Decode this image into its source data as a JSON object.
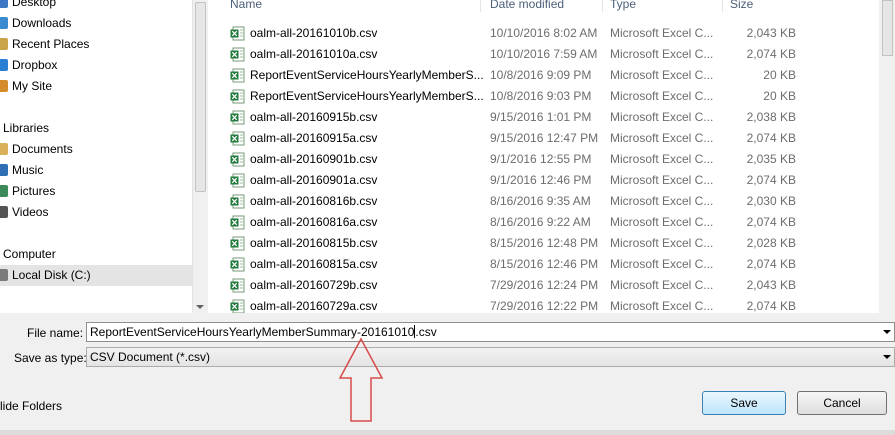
{
  "nav": {
    "items": [
      {
        "label": "Desktop",
        "icon": "desktop-icon",
        "group": false,
        "selected": false
      },
      {
        "label": "Downloads",
        "icon": "downloads-icon",
        "group": false,
        "selected": false
      },
      {
        "label": "Recent Places",
        "icon": "recent-places-icon",
        "group": false,
        "selected": false
      },
      {
        "label": "Dropbox",
        "icon": "dropbox-icon",
        "group": false,
        "selected": false
      },
      {
        "label": "My Site",
        "icon": "site-icon",
        "group": false,
        "selected": false
      },
      {
        "label": "Libraries",
        "icon": "",
        "group": true,
        "selected": false
      },
      {
        "label": "Documents",
        "icon": "documents-icon",
        "group": false,
        "selected": false
      },
      {
        "label": "Music",
        "icon": "music-icon",
        "group": false,
        "selected": false
      },
      {
        "label": "Pictures",
        "icon": "pictures-icon",
        "group": false,
        "selected": false
      },
      {
        "label": "Videos",
        "icon": "videos-icon",
        "group": false,
        "selected": false
      },
      {
        "label": "Computer",
        "icon": "",
        "group": true,
        "selected": false
      },
      {
        "label": "Local Disk (C:)",
        "icon": "local-disk-icon",
        "group": false,
        "selected": true
      }
    ]
  },
  "columns": {
    "name": "Name",
    "date": "Date modified",
    "type": "Type",
    "size": "Size"
  },
  "files": [
    {
      "name": "oalm-all-20161010b.csv",
      "date": "10/10/2016 8:02 AM",
      "type": "Microsoft Excel C...",
      "size": "2,043 KB"
    },
    {
      "name": "oalm-all-20161010a.csv",
      "date": "10/10/2016 7:59 AM",
      "type": "Microsoft Excel C...",
      "size": "2,074 KB"
    },
    {
      "name": "ReportEventServiceHoursYearlyMemberS...",
      "date": "10/8/2016 9:09 PM",
      "type": "Microsoft Excel C...",
      "size": "20 KB"
    },
    {
      "name": "ReportEventServiceHoursYearlyMemberS...",
      "date": "10/8/2016 9:03 PM",
      "type": "Microsoft Excel C...",
      "size": "20 KB"
    },
    {
      "name": "oalm-all-20160915b.csv",
      "date": "9/15/2016 1:01 PM",
      "type": "Microsoft Excel C...",
      "size": "2,038 KB"
    },
    {
      "name": "oalm-all-20160915a.csv",
      "date": "9/15/2016 12:47 PM",
      "type": "Microsoft Excel C...",
      "size": "2,074 KB"
    },
    {
      "name": "oalm-all-20160901b.csv",
      "date": "9/1/2016 12:55 PM",
      "type": "Microsoft Excel C...",
      "size": "2,035 KB"
    },
    {
      "name": "oalm-all-20160901a.csv",
      "date": "9/1/2016 12:46 PM",
      "type": "Microsoft Excel C...",
      "size": "2,074 KB"
    },
    {
      "name": "oalm-all-20160816b.csv",
      "date": "8/16/2016 9:35 AM",
      "type": "Microsoft Excel C...",
      "size": "2,030 KB"
    },
    {
      "name": "oalm-all-20160816a.csv",
      "date": "8/16/2016 9:22 AM",
      "type": "Microsoft Excel C...",
      "size": "2,074 KB"
    },
    {
      "name": "oalm-all-20160815b.csv",
      "date": "8/15/2016 12:48 PM",
      "type": "Microsoft Excel C...",
      "size": "2,028 KB"
    },
    {
      "name": "oalm-all-20160815a.csv",
      "date": "8/15/2016 12:46 PM",
      "type": "Microsoft Excel C...",
      "size": "2,074 KB"
    },
    {
      "name": "oalm-all-20160729b.csv",
      "date": "7/29/2016 12:24 PM",
      "type": "Microsoft Excel C...",
      "size": "2,043 KB"
    },
    {
      "name": "oalm-all-20160729a.csv",
      "date": "7/29/2016 12:22 PM",
      "type": "Microsoft Excel C...",
      "size": "2,074 KB"
    }
  ],
  "form": {
    "filename_label": "File name:",
    "filename_value_before_caret": "ReportEventServiceHoursYearlyMemberSummary-20161010",
    "filename_value_after_caret": ".csv",
    "savetype_label": "Save as type:",
    "savetype_value": "CSV Document (*.csv)"
  },
  "hide_folders_label": "lide Folders",
  "buttons": {
    "save": "Save",
    "cancel": "Cancel"
  },
  "colors": {
    "annotation_arrow": "#d84a4a",
    "excel_green": "#1f7a3c",
    "header_text": "#4c607a"
  }
}
